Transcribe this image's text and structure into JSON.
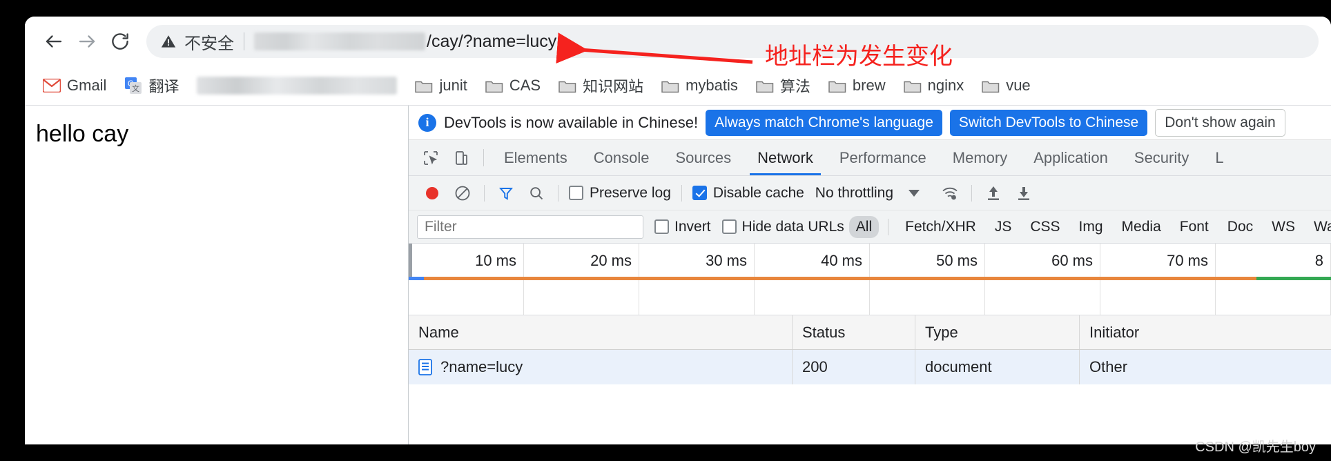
{
  "browser": {
    "nav": {
      "back_label": "Back",
      "forward_label": "Forward",
      "reload_label": "Reload"
    },
    "omnibox": {
      "security_icon": "warning-triangle-icon",
      "security_text": "不安全",
      "url_redacted": true,
      "url_visible": "/cay/?name=lucy"
    },
    "bookmarks": [
      {
        "label": "Gmail",
        "icon": "gmail-icon"
      },
      {
        "label": "翻译",
        "icon": "google-translate-icon"
      },
      {
        "label": "",
        "icon": "redacted-bookmark"
      },
      {
        "label": "junit",
        "icon": "folder-icon"
      },
      {
        "label": "CAS",
        "icon": "folder-icon"
      },
      {
        "label": "知识网站",
        "icon": "folder-icon"
      },
      {
        "label": "mybatis",
        "icon": "folder-icon"
      },
      {
        "label": "算法",
        "icon": "folder-icon"
      },
      {
        "label": "brew",
        "icon": "folder-icon"
      },
      {
        "label": "nginx",
        "icon": "folder-icon"
      },
      {
        "label": "vue",
        "icon": "folder-icon"
      }
    ]
  },
  "page": {
    "body_text": "hello cay"
  },
  "devtools": {
    "notice": {
      "icon": "info-icon",
      "message": "DevTools is now available in Chinese!",
      "buttons": [
        {
          "label": "Always match Chrome's language",
          "style": "primary"
        },
        {
          "label": "Switch DevTools to Chinese",
          "style": "primary"
        },
        {
          "label": "Don't show again",
          "style": "secondary"
        }
      ]
    },
    "tabs": [
      {
        "label": "Elements",
        "active": false
      },
      {
        "label": "Console",
        "active": false
      },
      {
        "label": "Sources",
        "active": false
      },
      {
        "label": "Network",
        "active": true
      },
      {
        "label": "Performance",
        "active": false
      },
      {
        "label": "Memory",
        "active": false
      },
      {
        "label": "Application",
        "active": false
      },
      {
        "label": "Security",
        "active": false
      },
      {
        "label": "L",
        "active": false
      }
    ],
    "network_toolbar": {
      "record_label": "Record",
      "clear_label": "Clear",
      "filter_toggle_label": "Filter",
      "search_label": "Search",
      "preserve_log": {
        "label": "Preserve log",
        "checked": false
      },
      "disable_cache": {
        "label": "Disable cache",
        "checked": true
      },
      "throttling": "No throttling",
      "network_conditions_label": "Network conditions",
      "import_har_label": "Import HAR",
      "export_har_label": "Export HAR"
    },
    "filter_bar": {
      "filter_placeholder": "Filter",
      "filter_value": "",
      "invert": {
        "label": "Invert",
        "checked": false
      },
      "hide_data_urls": {
        "label": "Hide data URLs",
        "checked": false
      },
      "types": [
        {
          "label": "All",
          "active": true
        },
        {
          "label": "Fetch/XHR",
          "active": false
        },
        {
          "label": "JS",
          "active": false
        },
        {
          "label": "CSS",
          "active": false
        },
        {
          "label": "Img",
          "active": false
        },
        {
          "label": "Media",
          "active": false
        },
        {
          "label": "Font",
          "active": false
        },
        {
          "label": "Doc",
          "active": false
        },
        {
          "label": "WS",
          "active": false
        },
        {
          "label": "Wa",
          "active": false
        }
      ]
    },
    "overview": {
      "ticks": [
        "10 ms",
        "20 ms",
        "30 ms",
        "40 ms",
        "50 ms",
        "60 ms",
        "70 ms",
        "8"
      ],
      "bar_colors": {
        "blue": "#4285f4",
        "orange": "#e8863c",
        "green": "#34a853"
      }
    },
    "requests": {
      "columns": [
        "Name",
        "Status",
        "Type",
        "Initiator"
      ],
      "rows": [
        {
          "icon": "document-icon",
          "name": "?name=lucy",
          "status": "200",
          "type": "document",
          "initiator": "Other"
        }
      ]
    }
  },
  "annotation": {
    "text": "地址栏为发生变化",
    "color": "#f5221e",
    "arrow": "left-arrow"
  },
  "watermark": "CSDN @凯先生boy"
}
